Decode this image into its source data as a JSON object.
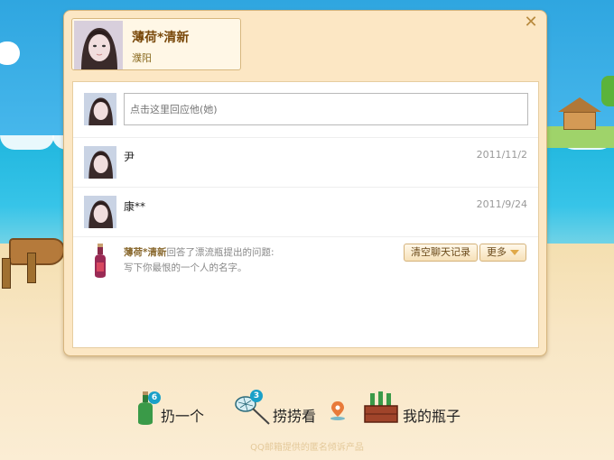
{
  "profile": {
    "name": "薄荷*清新",
    "location": "濮阳"
  },
  "reply": {
    "placeholder": "点击这里回应他(她)"
  },
  "messages": [
    {
      "text": "尹",
      "date": "2011/11/2"
    },
    {
      "text": "康**",
      "date": "2011/9/24"
    }
  ],
  "system_message": {
    "sender": "薄荷*清新",
    "action": "回答了漂流瓶提出的问题:",
    "question": "写下你最恨的一个人的名字。"
  },
  "buttons": {
    "clear_chat": "清空聊天记录",
    "more": "更多"
  },
  "nav": [
    {
      "label": "扔一个",
      "badge": "6"
    },
    {
      "label": "捞捞看",
      "badge": "3"
    },
    {
      "label": "我的瓶子"
    }
  ],
  "footer": "QQ邮箱提供的匿名倾诉产品",
  "colors": {
    "accent": "#7a4a0c",
    "badge": "#1aa0c8",
    "dialog_bg": "#fce7c4"
  }
}
